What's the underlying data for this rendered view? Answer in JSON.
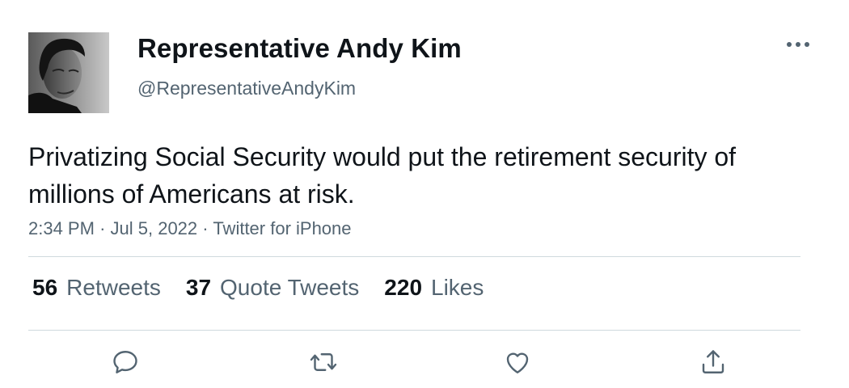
{
  "author": {
    "name": "Representative Andy Kim",
    "handle": "@RepresentativeAndyKim",
    "avatar_icon": "profile-photo"
  },
  "tweet": {
    "text": "Privatizing Social Security would put the retirement security of millions of Americans at risk.",
    "time": "2:34 PM",
    "date": "Jul 5, 2022",
    "source": "Twitter for iPhone",
    "separator": "·"
  },
  "stats": {
    "retweets": {
      "count": "56",
      "label": "Retweets"
    },
    "quote_tweets": {
      "count": "37",
      "label": "Quote Tweets"
    },
    "likes": {
      "count": "220",
      "label": "Likes"
    }
  },
  "actions": {
    "reply_icon": "reply-icon",
    "retweet_icon": "retweet-icon",
    "like_icon": "like-icon",
    "share_icon": "share-icon"
  },
  "colors": {
    "text_primary": "#0f1419",
    "text_secondary": "#536471",
    "divider": "#cfd9de",
    "icon": "#536471"
  }
}
